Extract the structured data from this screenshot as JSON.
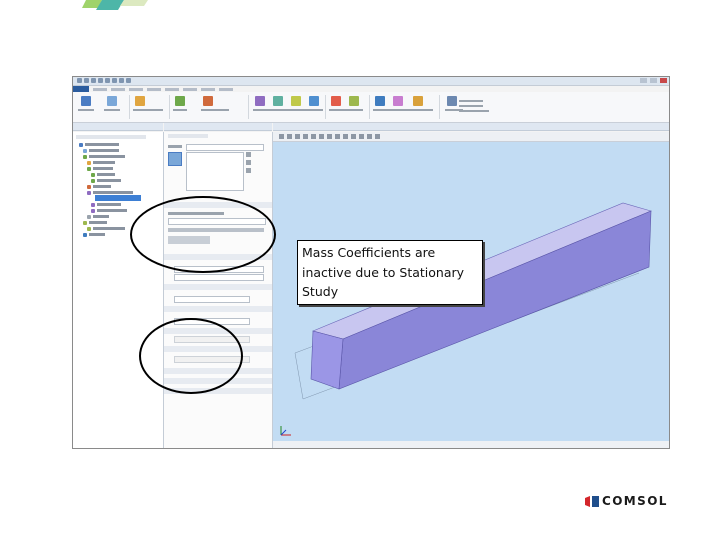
{
  "slide": {
    "annotation_text": "Mass Coefficients are inactive due to Stationary Study"
  },
  "logo": {
    "text": "COMSOL",
    "colors": {
      "mark_red": "#d4262b",
      "mark_blue": "#1f4e8c",
      "text": "#1a1a1a"
    }
  },
  "screenshot": {
    "colors": {
      "graphics_background": "#c2dcf3",
      "geometry_top_face": "#c8c6f0",
      "geometry_front_face": "#8a86d8",
      "geometry_end_face": "#9b96e6",
      "highlight_ellipse": "#000000",
      "file_tab": "#2b5c9e"
    }
  },
  "icons": [
    "comsol-logo-icon",
    "graphics-axis-triad-icon"
  ]
}
